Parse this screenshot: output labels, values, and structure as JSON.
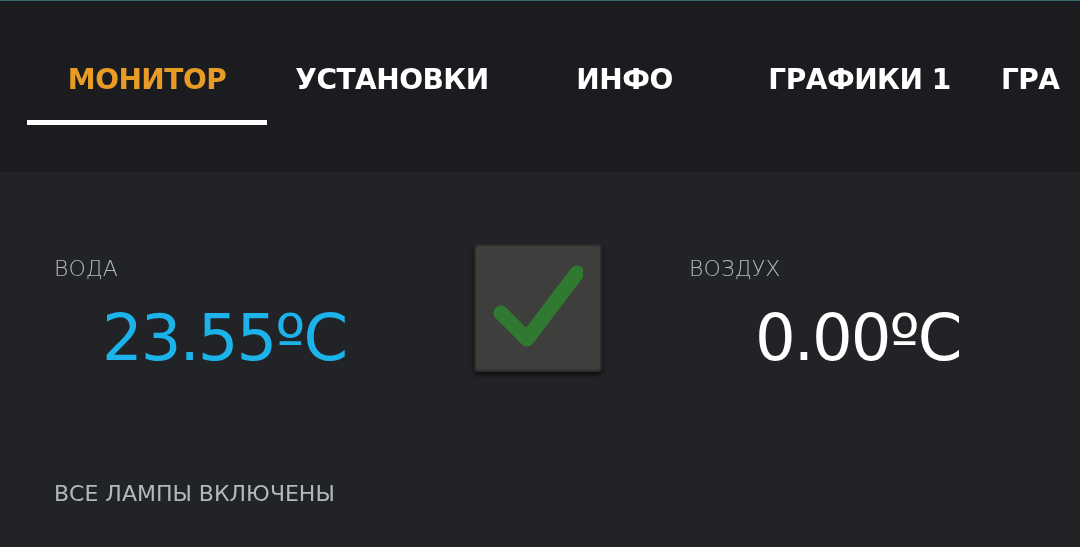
{
  "tabs": [
    {
      "label": "МОНИТОР",
      "selected": true
    },
    {
      "label": "УСТАНОВКИ",
      "selected": false
    },
    {
      "label": "ИНФО",
      "selected": false
    },
    {
      "label": "ГРАФИКИ 1",
      "selected": false
    },
    {
      "label": "ГРА",
      "selected": false
    }
  ],
  "water": {
    "label": "ВОДА",
    "value": "23.55ºC"
  },
  "status_checkbox": {
    "checked": true
  },
  "air": {
    "label": "ВОЗДУХ",
    "value": "0.00ºC"
  },
  "lamps_status": "ВСЕ ЛАМПЫ ВКЛЮЧЕНЫ"
}
